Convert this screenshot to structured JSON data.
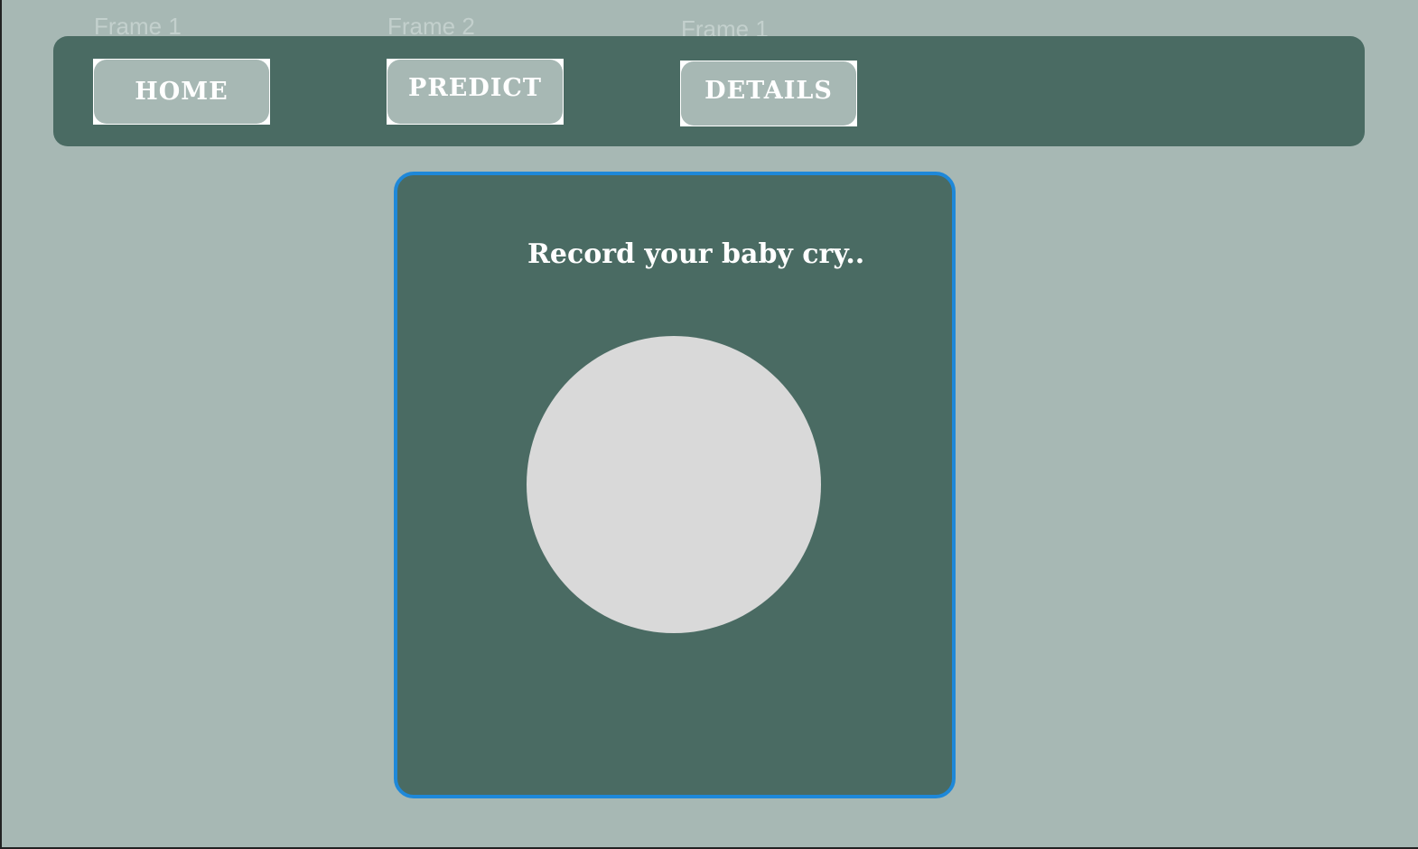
{
  "frames": {
    "frame_a_label": "Frame 1",
    "frame_b_label": "Frame 2",
    "frame_c_label": "Frame 1"
  },
  "nav": {
    "home_label": "HOME",
    "predict_label": "PREDICT",
    "details_label": "DETAILS"
  },
  "card": {
    "title": "Record your baby cry.."
  },
  "colors": {
    "page_background": "#a7b8b4",
    "panel_background": "#4a6b63",
    "card_border_selected": "#1e88d9",
    "record_circle": "#d9d9d9",
    "text": "#ffffff"
  }
}
